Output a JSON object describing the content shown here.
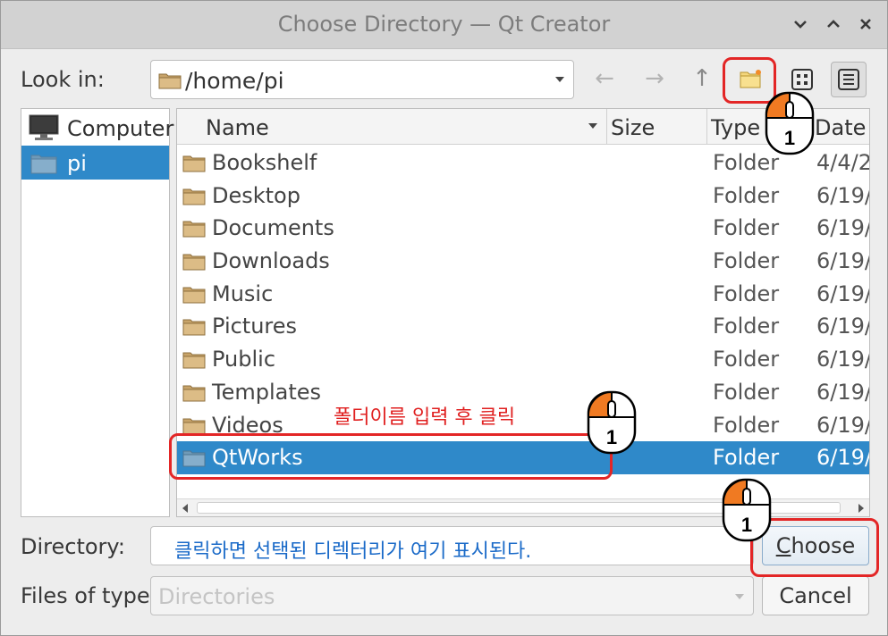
{
  "window": {
    "title": "Choose Directory — Qt Creator",
    "controls": [
      "chevron-down-icon",
      "chevron-up-icon",
      "close-icon"
    ]
  },
  "look_in": {
    "label": "Look in:",
    "value": "/home/pi",
    "nav": {
      "back": "←",
      "forward": "→",
      "up": "↑"
    }
  },
  "sidebar": {
    "items": [
      {
        "label": "Computer",
        "icon": "computer-icon",
        "selected": false
      },
      {
        "label": "pi",
        "icon": "folder-icon",
        "selected": true
      }
    ]
  },
  "file_list": {
    "columns": [
      "Name",
      "Size",
      "Type",
      "Date M"
    ],
    "rows": [
      {
        "name": "Bookshelf",
        "type": "Folder",
        "date": "4/4/2"
      },
      {
        "name": "Desktop",
        "type": "Folder",
        "date": "6/19/"
      },
      {
        "name": "Documents",
        "type": "Folder",
        "date": "6/19/"
      },
      {
        "name": "Downloads",
        "type": "Folder",
        "date": "6/19/"
      },
      {
        "name": "Music",
        "type": "Folder",
        "date": "6/19/"
      },
      {
        "name": "Pictures",
        "type": "Folder",
        "date": "6/19/"
      },
      {
        "name": "Public",
        "type": "Folder",
        "date": "6/19/"
      },
      {
        "name": "Templates",
        "type": "Folder",
        "date": "6/19/"
      },
      {
        "name": "Videos",
        "type": "Folder",
        "date": "6/19/"
      },
      {
        "name": "QtWorks",
        "type": "Folder",
        "date": "6/19/",
        "selected": true
      }
    ]
  },
  "directory": {
    "label": "Directory:",
    "value": ""
  },
  "files_of_type": {
    "label": "Files of type:",
    "placeholder": "Directories"
  },
  "buttons": {
    "choose": "Choose",
    "choose_mnemonic": "C",
    "choose_rest": "hoose",
    "cancel": "Cancel"
  },
  "annotations": {
    "folder_hint": "폴더이름 입력 후 클릭",
    "directory_hint": "클릭하면 선택된 디렉터리가 여기 표시된다.",
    "step_number": "1"
  },
  "colors": {
    "selection": "#2f89c9",
    "annotation_red": "#e32626",
    "annotation_blue": "#1a6ac8",
    "mouse_accent": "#f07a22"
  }
}
